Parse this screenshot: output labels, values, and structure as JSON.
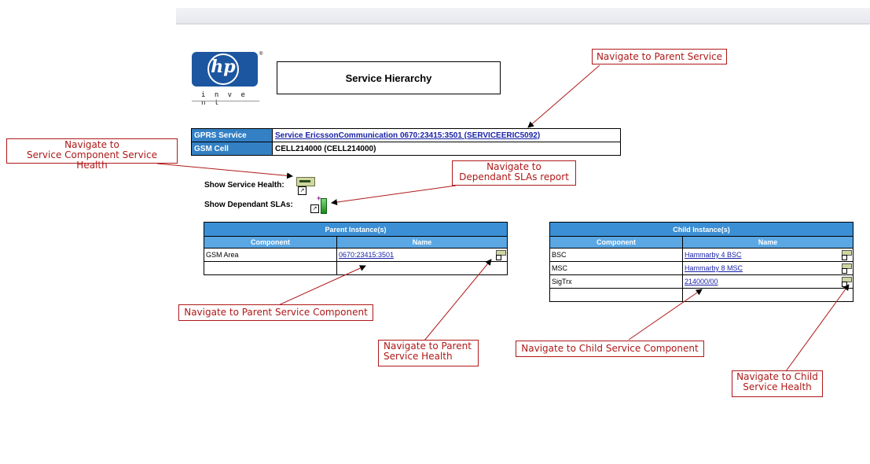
{
  "logo": {
    "text": "hp",
    "tagline": "i n v e n t",
    "reg": "®"
  },
  "page_title": "Service Hierarchy",
  "info": {
    "rows": [
      {
        "label": "GPRS Service",
        "value": "Service EricssonCommunication 0670:23415:3501 (SERVICEERIC5092)",
        "is_link": true
      },
      {
        "label": "GSM Cell",
        "value": "CELL214000 (CELL214000)",
        "is_link": false
      }
    ]
  },
  "show": {
    "service_health_label": "Show Service Health:",
    "dependant_slas_label": "Show Dependant SLAs:"
  },
  "parent": {
    "title": "Parent Instance(s)",
    "col_component": "Component",
    "col_name": "Name",
    "rows": [
      {
        "component": "GSM Area",
        "name": "0670:23415:3501"
      }
    ]
  },
  "child": {
    "title": "Child Instance(s)",
    "col_component": "Component",
    "col_name": "Name",
    "rows": [
      {
        "component": "BSC",
        "name": "Hammarby 4 BSC"
      },
      {
        "component": "MSC",
        "name": "Hammarby 8 MSC"
      },
      {
        "component": "SigTrx",
        "name": "214000/00"
      }
    ]
  },
  "callouts": {
    "parent_service": "Navigate to Parent Service",
    "service_component_health_1": "Navigate to",
    "service_component_health_2": "Service Component Service Health",
    "dependant_slas_1": "Navigate to",
    "dependant_slas_2": "Dependant SLAs report",
    "parent_component": "Navigate to Parent Service Component",
    "parent_health_1": "Navigate to Parent",
    "parent_health_2": "Service Health",
    "child_component": "Navigate to Child Service Component",
    "child_health_1": "Navigate to Child",
    "child_health_2": "Service Health"
  },
  "colors": {
    "header_blue": "#3380c4",
    "callout_red": "#b01818",
    "link": "#1a23a8"
  }
}
